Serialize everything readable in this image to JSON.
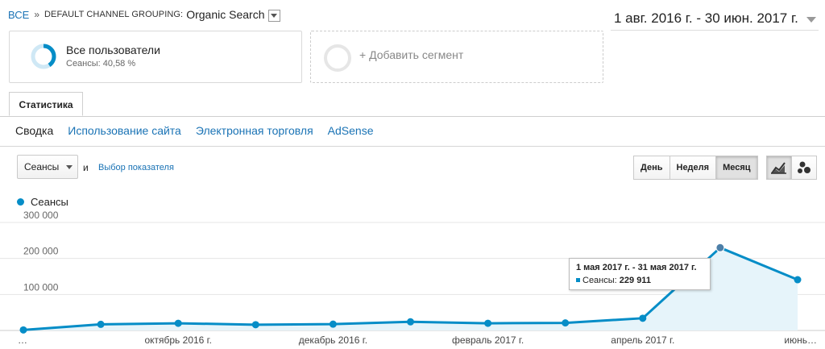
{
  "breadcrumb": {
    "all": "ВСЕ",
    "separator": "»",
    "grouping": "DEFAULT CHANNEL GROUPING:",
    "value": "Organic Search"
  },
  "date_range": "1 авг. 2016 г. - 30 июн. 2017 г.",
  "segments": {
    "active": {
      "title": "Все пользователи",
      "subtitle": "Сеансы: 40,58 %",
      "fraction": 0.4058
    },
    "add_label": "+ Добавить сегмент"
  },
  "tabs": [
    {
      "label": "Статистика"
    }
  ],
  "subnav": [
    "Сводка",
    "Использование сайта",
    "Электронная торговля",
    "AdSense"
  ],
  "controls": {
    "metric": "Сеансы",
    "and": "и",
    "pick_metric": "Выбор показателя",
    "granularity": [
      "День",
      "Неделя",
      "Месяц"
    ],
    "active_granularity": "Месяц",
    "view_icons": [
      "line-chart-icon",
      "motion-chart-icon"
    ]
  },
  "colors": {
    "series": "#058dc7",
    "fill": "#e6f4fa",
    "link": "#1a73b5"
  },
  "chart_data": {
    "type": "area",
    "series": [
      {
        "name": "Сеансы",
        "x": [
          "2016-08",
          "2016-09",
          "2016-10",
          "2016-11",
          "2016-12",
          "2017-01",
          "2017-02",
          "2017-03",
          "2017-04",
          "2017-05",
          "2017-06"
        ],
        "values": [
          1500,
          17000,
          20000,
          16000,
          17500,
          24000,
          20000,
          21000,
          34000,
          229911,
          141000
        ]
      }
    ],
    "ylim": [
      0,
      300000
    ],
    "y_ticks": [
      "100 000",
      "200 000",
      "300 000"
    ],
    "x_tick_labels": [
      {
        "index": 0,
        "label": "…"
      },
      {
        "index": 2,
        "label": "октябрь 2016 г."
      },
      {
        "index": 4,
        "label": "декабрь 2016 г."
      },
      {
        "index": 6,
        "label": "февраль 2017 г."
      },
      {
        "index": 8,
        "label": "апрель 2017 г."
      },
      {
        "index": 10,
        "label": "июнь…"
      }
    ],
    "grid": true,
    "tooltip": {
      "title": "1 мая 2017 г. - 31 мая 2017 г.",
      "series": "Сеансы:",
      "value": "229 911",
      "index": 9
    }
  }
}
